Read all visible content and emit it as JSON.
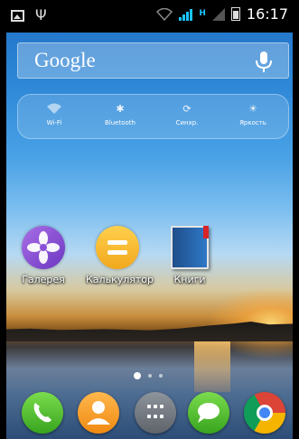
{
  "status_bar": {
    "time": "16:17",
    "network_type": "H"
  },
  "google_bar": {
    "logo_text": "Google"
  },
  "quick_settings": [
    {
      "label": "Wi-Fi",
      "icon": "wifi-icon"
    },
    {
      "label": "Bluetooth",
      "icon": "bluetooth-icon"
    },
    {
      "label": "Синхр.",
      "icon": "sync-icon"
    },
    {
      "label": "Яркость",
      "icon": "brightness-icon"
    }
  ],
  "apps": [
    {
      "label": "Галерея",
      "icon": "gallery-flower-icon"
    },
    {
      "label": "Калькулятор",
      "icon": "calculator-icon"
    },
    {
      "label": "Книги",
      "icon": "books-icon"
    }
  ],
  "pages": {
    "count": 3,
    "current": 1
  },
  "dock": [
    {
      "name": "phone",
      "icon": "phone-icon",
      "color": "#4cbc2a"
    },
    {
      "name": "contacts",
      "icon": "contacts-icon",
      "color": "#f5a21d"
    },
    {
      "name": "all-apps",
      "icon": "app-drawer-icon",
      "color": "#6f747b"
    },
    {
      "name": "messages",
      "icon": "message-bubble-icon",
      "color": "#4cbc2a"
    },
    {
      "name": "chrome",
      "icon": "chrome-icon",
      "color": "#4285f4"
    }
  ]
}
